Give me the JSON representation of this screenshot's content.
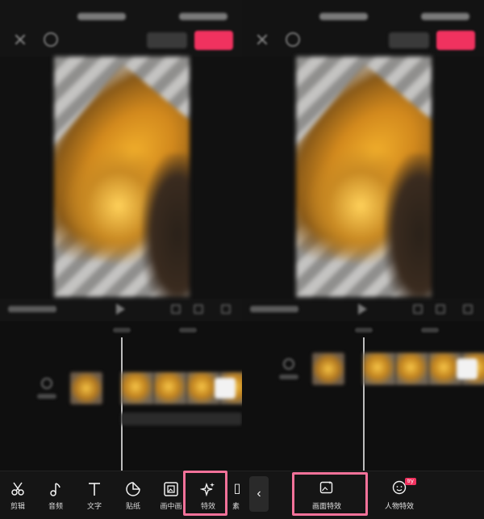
{
  "left_screen": {
    "toolbar": {
      "items": [
        {
          "label": "剪辑",
          "icon": "scissors-icon"
        },
        {
          "label": "音频",
          "icon": "music-note-icon"
        },
        {
          "label": "文字",
          "icon": "text-icon"
        },
        {
          "label": "贴纸",
          "icon": "sticker-icon"
        },
        {
          "label": "画中画",
          "icon": "picture-in-picture-icon"
        },
        {
          "label": "特效",
          "icon": "sparkle-effects-icon"
        }
      ],
      "cut_label": "素",
      "highlighted": "特效"
    }
  },
  "right_screen": {
    "effects_menu": {
      "back_icon": "chevron-left-icon",
      "items": [
        {
          "label": "画面特效",
          "icon": "image-sparkle-icon"
        },
        {
          "label": "人物特效",
          "icon": "face-icon",
          "badge": "try"
        }
      ],
      "highlighted": "画面特效"
    }
  },
  "colors": {
    "accent": "#f0325f",
    "highlight_border": "#f4729a",
    "background": "#141414"
  }
}
